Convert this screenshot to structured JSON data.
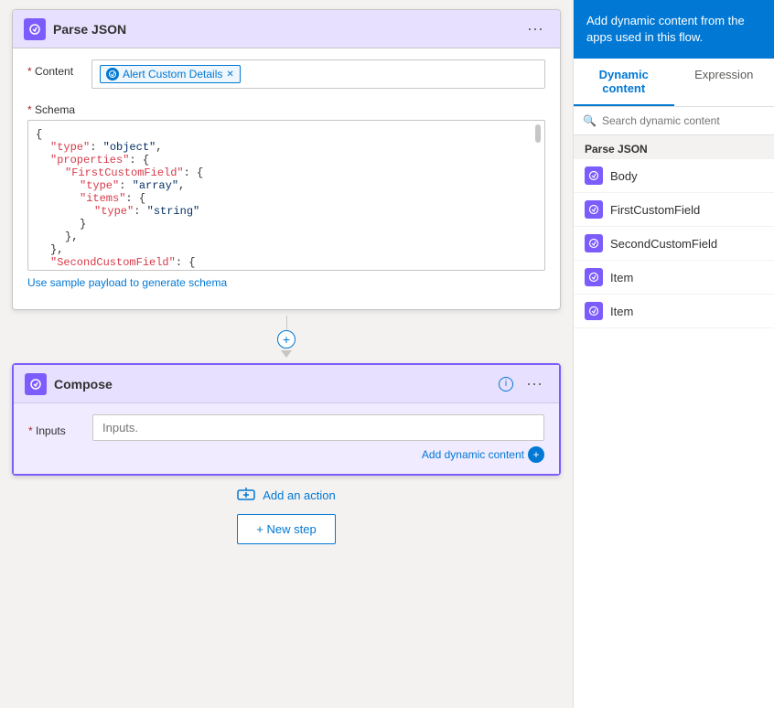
{
  "parseJson": {
    "title": "Parse JSON",
    "contentLabel": "* Content",
    "schemaLabel": "* Schema",
    "tagText": "Alert Custom Details",
    "schemaLink": "Use sample payload to generate schema",
    "schemaCode": [
      "{",
      "    \"type\": \"object\",",
      "    \"properties\": {",
      "        \"FirstCustomField\": {",
      "            \"type\": \"array\",",
      "            \"items\": {",
      "                \"type\": \"string\"",
      "            }",
      "        },",
      "    },",
      "    \"SecondCustomField\": {"
    ]
  },
  "compose": {
    "title": "Compose",
    "inputsLabel": "* Inputs",
    "inputsPlaceholder": "Inputs.",
    "addDynamicLabel": "Add dynamic content"
  },
  "canvas": {
    "addActionLabel": "Add an action",
    "newStepLabel": "+ New step"
  },
  "rightPanel": {
    "headerText": "Add dynamic content from the apps used in this flow.",
    "tabs": [
      "Dynamic content",
      "Expression"
    ],
    "activeTab": 0,
    "searchPlaceholder": "Search dynamic content",
    "sectionLabel": "Parse JSON",
    "items": [
      {
        "label": "Body"
      },
      {
        "label": "FirstCustomField"
      },
      {
        "label": "SecondCustomField"
      },
      {
        "label": "Item"
      },
      {
        "label": "Item"
      }
    ]
  }
}
